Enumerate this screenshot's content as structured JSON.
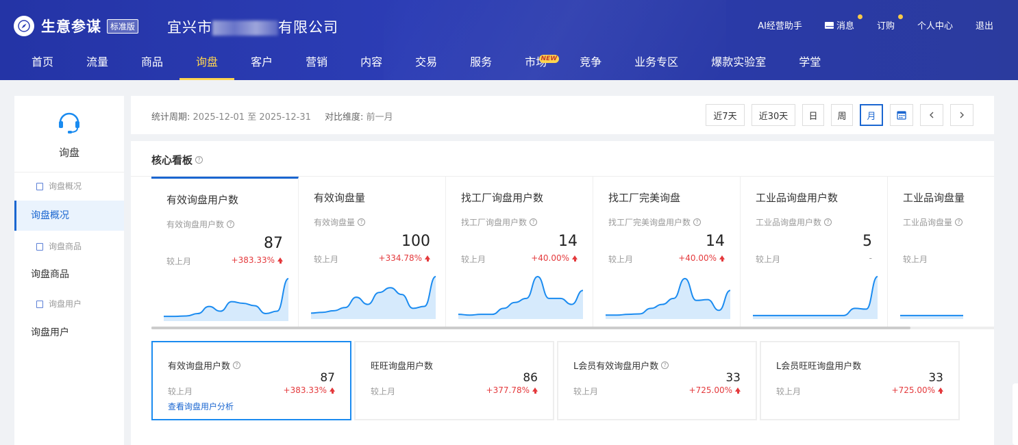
{
  "header": {
    "brand": "生意参谋",
    "edition": "标准版",
    "company_prefix": "宜兴市",
    "company_suffix": "有限公司",
    "links": [
      {
        "label": "AI经营助手",
        "dot": false
      },
      {
        "label": "消息",
        "dot": true,
        "icon": "mail-icon"
      },
      {
        "label": "订购",
        "dot": true
      },
      {
        "label": "个人中心",
        "dot": false
      },
      {
        "label": "退出",
        "dot": false
      }
    ],
    "nav": [
      {
        "label": "首页"
      },
      {
        "label": "流量"
      },
      {
        "label": "商品"
      },
      {
        "label": "询盘",
        "active": true
      },
      {
        "label": "客户"
      },
      {
        "label": "营销"
      },
      {
        "label": "内容"
      },
      {
        "label": "交易"
      },
      {
        "label": "服务"
      },
      {
        "label": "市场",
        "badge": "NEW"
      },
      {
        "label": "竞争"
      },
      {
        "label": "业务专区"
      },
      {
        "label": "爆款实验室"
      },
      {
        "label": "学堂"
      }
    ],
    "accent": "#ffd54f"
  },
  "sidebar": {
    "title": "询盘",
    "icon": "headset-icon",
    "items": [
      {
        "label": "询盘概况",
        "type": "sub"
      },
      {
        "label": "询盘概况",
        "type": "main",
        "active": true
      },
      {
        "label": "询盘商品",
        "type": "sub"
      },
      {
        "label": "询盘商品",
        "type": "main"
      },
      {
        "label": "询盘用户",
        "type": "sub"
      },
      {
        "label": "询盘用户",
        "type": "main"
      }
    ]
  },
  "period": {
    "label": "统计周期:",
    "range": "2025-12-01 至 2025-12-31",
    "compare_label": "对比维度:",
    "compare_value": "前一月",
    "buttons": [
      "近7天",
      "近30天",
      "日",
      "周",
      "月"
    ],
    "active_button": "月"
  },
  "board": {
    "title": "核心看板",
    "metrics": [
      {
        "title": "有效询盘用户数",
        "sub": "有效询盘用户数",
        "value": "87",
        "cmp": "较上月",
        "change": "+383.33%",
        "trend": [
          0.05,
          0.05,
          0.06,
          0.12,
          0.3,
          0.18,
          0.42,
          0.38,
          0.32,
          0.12,
          0.18,
          1.0
        ],
        "active": true
      },
      {
        "title": "有效询盘量",
        "sub": "有效询盘量",
        "value": "100",
        "cmp": "较上月",
        "change": "+334.78%",
        "trend": [
          0.08,
          0.1,
          0.14,
          0.22,
          0.48,
          0.3,
          0.6,
          0.72,
          0.55,
          0.2,
          0.25,
          1.0
        ]
      },
      {
        "title": "找工厂询盘用户数",
        "sub": "找工厂询盘用户数",
        "value": "14",
        "cmp": "较上月",
        "change": "+40.00%",
        "trend": [
          0.05,
          0.03,
          0.05,
          0.05,
          0.2,
          0.35,
          0.45,
          1.0,
          0.45,
          0.45,
          0.3,
          0.65
        ]
      },
      {
        "title": "找工厂完美询盘",
        "sub": "找工厂完美询盘用户数",
        "value": "14",
        "cmp": "较上月",
        "change": "+40.00%",
        "trend": [
          0.03,
          0.03,
          0.05,
          0.06,
          0.2,
          0.3,
          0.45,
          0.95,
          0.4,
          0.42,
          0.15,
          0.65
        ]
      },
      {
        "title": "工业品询盘用户数",
        "sub": "工业品询盘用户数",
        "value": "5",
        "cmp": "较上月",
        "change": "-",
        "trend": [
          0.02,
          0.02,
          0.02,
          0.02,
          0.02,
          0.02,
          0.02,
          0.02,
          0.02,
          0.2,
          0.18,
          1.0
        ]
      },
      {
        "title": "工业品询盘量",
        "sub": "工业品询盘量",
        "value": "",
        "cmp": "较上月",
        "change": "",
        "trend": [
          0.02,
          0.02,
          0.02,
          0.02,
          0.02,
          0.02,
          0.02,
          0.02
        ]
      }
    ],
    "cards": [
      {
        "title": "有效询盘用户数",
        "help": true,
        "value": "87",
        "cmp": "较上月",
        "change": "+383.33%",
        "link": "查看询盘用户分析",
        "active": true
      },
      {
        "title": "旺旺询盘用户数",
        "help": false,
        "value": "86",
        "cmp": "较上月",
        "change": "+377.78%"
      },
      {
        "title": "L会员有效询盘用户数",
        "help": true,
        "value": "33",
        "cmp": "较上月",
        "change": "+725.00%"
      },
      {
        "title": "L会员旺旺询盘用户数",
        "help": false,
        "value": "33",
        "cmp": "较上月",
        "change": "+725.00%"
      }
    ],
    "line_color": "#1a8bf0",
    "area_color": "#d6eafc",
    "up_color": "#e4393c"
  }
}
